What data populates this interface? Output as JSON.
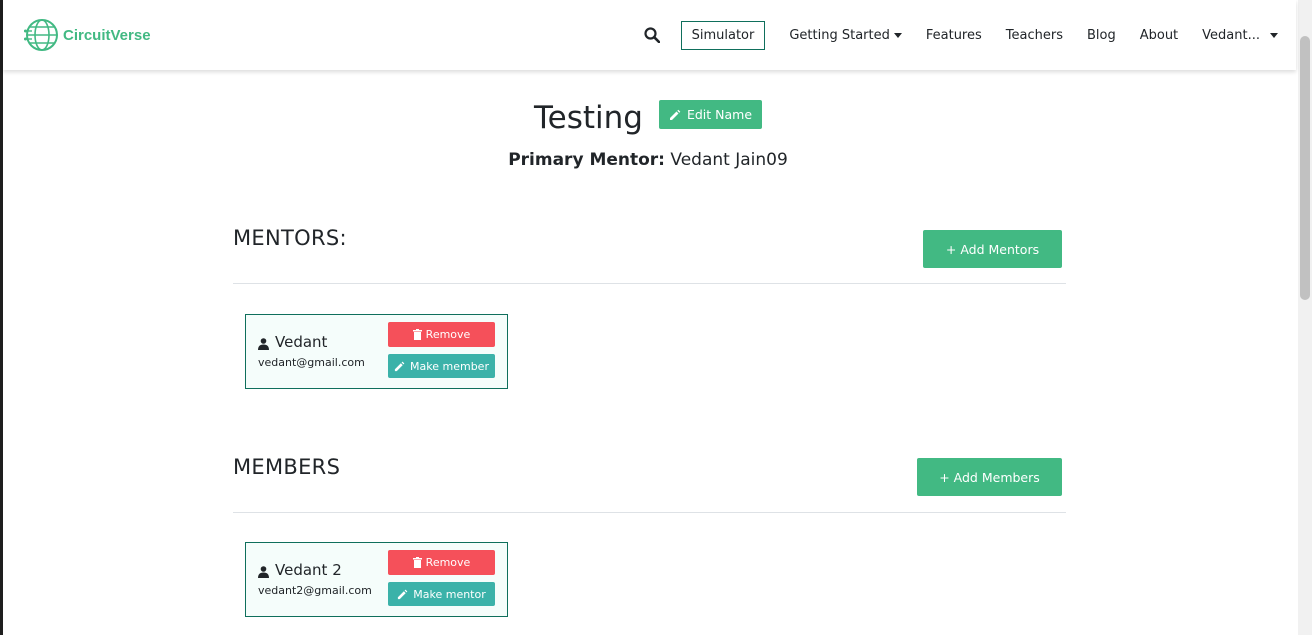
{
  "nav": {
    "brand": "CircuitVerse",
    "simulator": "Simulator",
    "links": [
      "Getting Started",
      "Features",
      "Teachers",
      "Blog",
      "About"
    ],
    "user": "Vedant...",
    "icons": {
      "search": "search-icon",
      "logo": "circuitverse-logo"
    }
  },
  "group": {
    "name": "Testing",
    "edit_label": "Edit Name",
    "primary_mentor_label": "Primary Mentor:",
    "primary_mentor": "Vedant Jain09"
  },
  "mentors": {
    "title": "MENTORS:",
    "add_label": "+ Add Mentors",
    "items": [
      {
        "name": "Vedant",
        "email": "vedant@gmail.com",
        "remove": "Remove",
        "action": "Make member"
      }
    ]
  },
  "members": {
    "title": "MEMBERS",
    "add_label": "+ Add Members",
    "items": [
      {
        "name": "Vedant 2",
        "email": "vedant2@gmail.com",
        "remove": "Remove",
        "action": "Make mentor"
      }
    ]
  },
  "colors": {
    "brand": "#42b983",
    "danger": "#f5505a",
    "teal": "#3bb2a9",
    "border": "#0f6f5c"
  }
}
